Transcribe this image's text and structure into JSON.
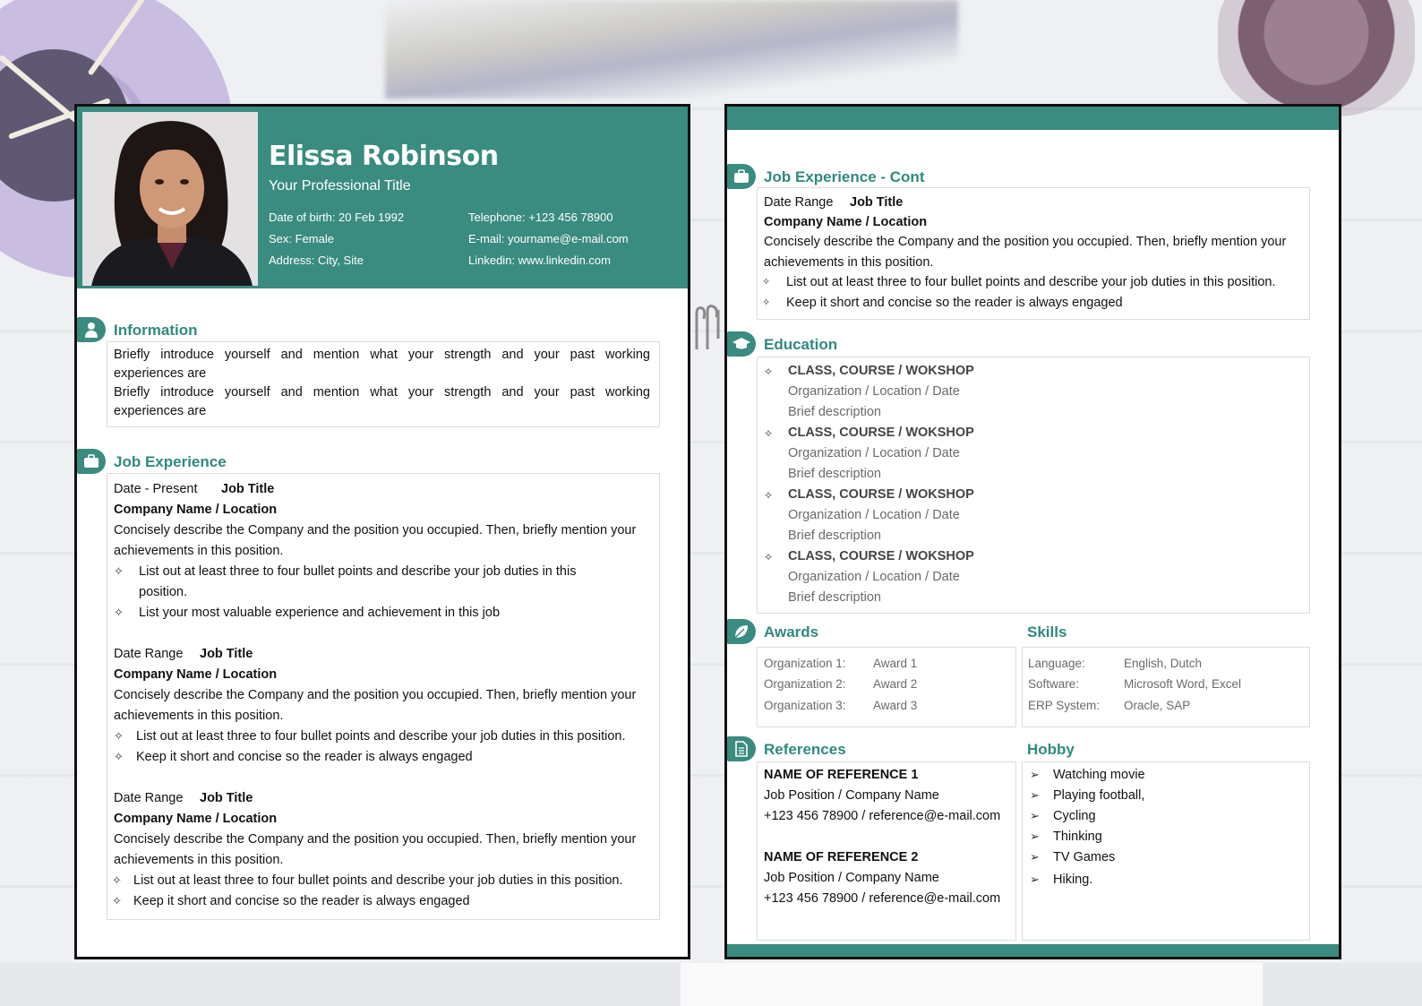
{
  "colors": {
    "accent": "#3a8b80",
    "heading": "#2f8a7d"
  },
  "left_page": {
    "header": {
      "name": "Elissa Robinson",
      "title": "Your Professional Title",
      "dob": "Date of birth: 20 Feb 1992",
      "sex": "Sex: Female",
      "address": "Address: City, Site",
      "telephone": "Telephone: +123 456 78900",
      "email": "E-mail: yourname@e-mail.com",
      "linkedin": "Linkedin: www.linkedin.com"
    },
    "information": {
      "title": "Information",
      "para1_l1": "Briefly introduce yourself and mention what your strength and your past working",
      "para1_l2": "experiences are",
      "para2_l1": "Briefly introduce yourself and mention what your strength and your past working",
      "para2_l2": "experiences are"
    },
    "job_experience": {
      "title": "Job Experience",
      "jobs": [
        {
          "date": "Date - Present",
          "job_title": "Job Title",
          "company": "Company Name / Location",
          "desc_l1": "Concisely describe the Company and the position you occupied. Then, briefly mention your",
          "desc_l2": "achievements in this position.",
          "b1_l1": "List out at least three to four bullet points and describe your job duties in this",
          "b1_l2": "position.",
          "b2": "List your most valuable experience and achievement in this job"
        },
        {
          "date": "Date Range",
          "job_title": "Job Title",
          "company": "Company Name / Location",
          "desc_l1": "Concisely describe the Company and the position you occupied. Then, briefly mention your",
          "desc_l2": "achievements in this position.",
          "b1": "List out at least three to four bullet points and describe your job duties in this position.",
          "b2": "Keep it short and concise so the reader is always engaged"
        },
        {
          "date": "Date Range",
          "job_title": "Job Title",
          "company": "Company Name / Location",
          "desc_l1": "Concisely describe the Company and the position you occupied. Then, briefly mention your",
          "desc_l2": "achievements in this position.",
          "b1": "List out at least three to four bullet points and describe your job duties in this position.",
          "b2": "Keep it short and concise so the reader is always engaged"
        }
      ]
    }
  },
  "right_page": {
    "job_cont": {
      "title": "Job Experience - Cont",
      "date": "Date Range",
      "job_title": "Job Title",
      "company": "Company Name / Location",
      "desc_l1": "Concisely describe the Company and the position you occupied. Then, briefly mention your",
      "desc_l2": "achievements in this position.",
      "b1": "List out at least three to four bullet points and describe your job duties in this position.",
      "b2": "Keep it short and concise so the reader is always engaged"
    },
    "education": {
      "title": "Education",
      "items": [
        {
          "course": "CLASS, COURSE / WOKSHOP",
          "org": "Organization / Location / Date",
          "desc": "Brief description"
        },
        {
          "course": "CLASS, COURSE / WOKSHOP",
          "org": "Organization / Location / Date",
          "desc": "Brief description"
        },
        {
          "course": "CLASS, COURSE / WOKSHOP",
          "org": "Organization / Location / Date",
          "desc": "Brief description"
        },
        {
          "course": "CLASS, COURSE / WOKSHOP",
          "org": "Organization / Location / Date",
          "desc": "Brief description"
        }
      ]
    },
    "awards": {
      "title": "Awards",
      "rows": [
        {
          "org": "Organization 1:",
          "award": "Award 1"
        },
        {
          "org": "Organization 2:",
          "award": "Award 2"
        },
        {
          "org": "Organization 3:",
          "award": "Award 3"
        }
      ]
    },
    "skills": {
      "title": "Skills",
      "rows": [
        {
          "label": "Language:",
          "value": "English, Dutch"
        },
        {
          "label": "Software:",
          "value": "Microsoft Word, Excel"
        },
        {
          "label": "ERP System:",
          "value": "Oracle, SAP"
        }
      ]
    },
    "references": {
      "title": "References",
      "items": [
        {
          "name": "NAME OF REFERENCE 1",
          "position": "Job Position / Company Name",
          "contact": "+123 456 78900 / reference@e-mail.com"
        },
        {
          "name": "NAME OF REFERENCE 2",
          "position": "Job Position / Company Name",
          "contact": "+123 456 78900 / reference@e-mail.com"
        }
      ]
    },
    "hobby": {
      "title": "Hobby",
      "items": [
        "Watching movie",
        "Playing football,",
        "Cycling",
        "Thinking",
        "TV Games",
        "Hiking."
      ]
    }
  }
}
